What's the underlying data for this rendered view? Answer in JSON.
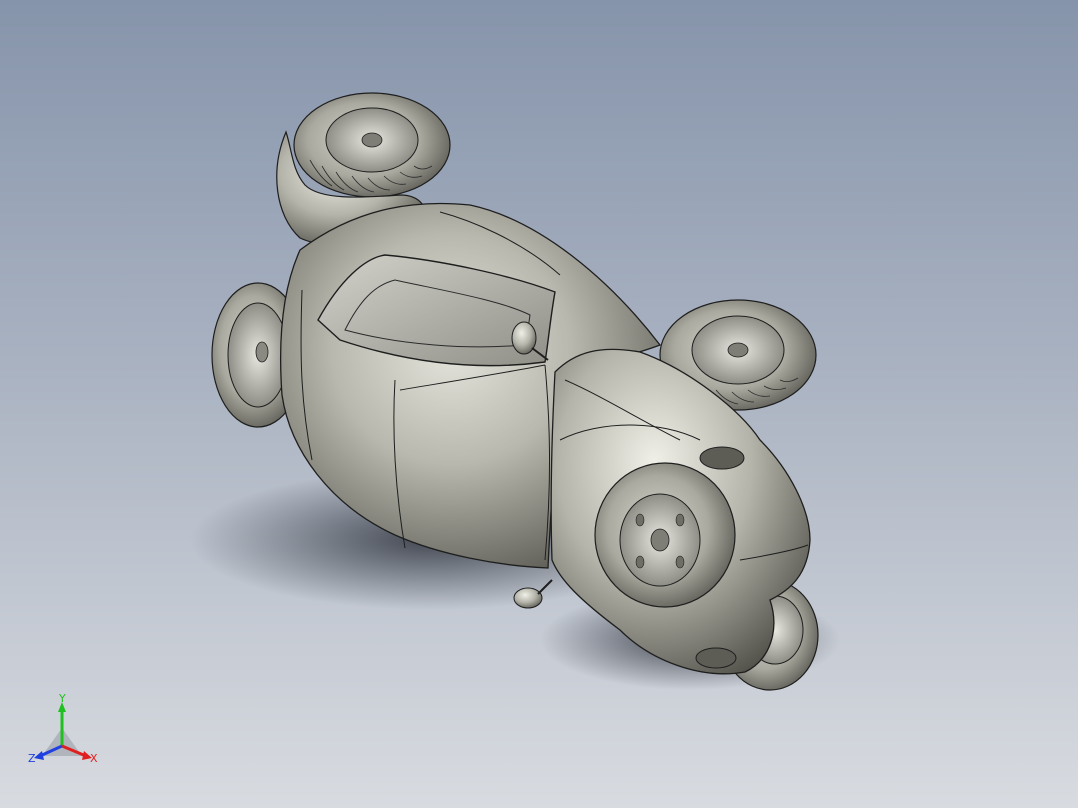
{
  "viewport": {
    "background_top": "#8694ab",
    "background_bottom": "#d8dbe0"
  },
  "model": {
    "body_color": "#b8b8ae",
    "body_shadow": "#55554e",
    "tire_color": "#a9a99f",
    "outline_color": "#1e1e1e",
    "ground_shadow": "#3d4350"
  },
  "triad": {
    "x_label": "X",
    "y_label": "Y",
    "z_label": "Z",
    "x_color": "#e02020",
    "y_color": "#20c020",
    "z_color": "#2040e0"
  }
}
